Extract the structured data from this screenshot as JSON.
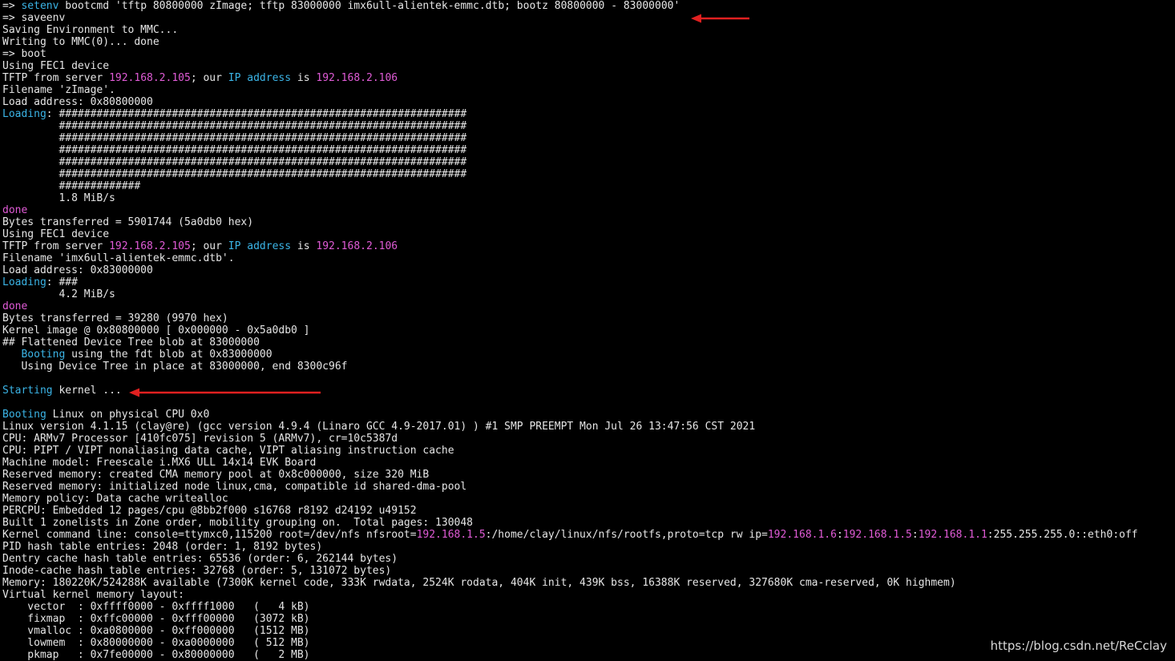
{
  "colors": {
    "background": "#000000",
    "default_text": "#e6e6e6",
    "cyan": "#3bb4e6",
    "magenta": "#e05bd6",
    "arrow": "#e02020"
  },
  "terminal": {
    "lines": [
      [
        [
          "d",
          "=> "
        ],
        [
          "c",
          "setenv"
        ],
        [
          "d",
          " bootcmd 'tftp 80800000 zImage; tftp 83000000 imx6ull-alientek-emmc.dtb; bootz 80800000 - 83000000'"
        ]
      ],
      [
        [
          "d",
          "=> saveenv"
        ]
      ],
      [
        [
          "d",
          "Saving Environment to MMC..."
        ]
      ],
      [
        [
          "d",
          "Writing to MMC(0)... done"
        ]
      ],
      [
        [
          "d",
          "=> boot"
        ]
      ],
      [
        [
          "d",
          "Using FEC1 device"
        ]
      ],
      [
        [
          "d",
          "TFTP from server "
        ],
        [
          "m",
          "192.168.2.105"
        ],
        [
          "d",
          "; our "
        ],
        [
          "c",
          "IP address"
        ],
        [
          "d",
          " is "
        ],
        [
          "m",
          "192.168.2.106"
        ]
      ],
      [
        [
          "d",
          "Filename 'zImage'."
        ]
      ],
      [
        [
          "d",
          "Load address: 0x80800000"
        ]
      ],
      [
        [
          "c",
          "Loading"
        ],
        [
          "d",
          ": #################################################################"
        ]
      ],
      [
        [
          "d",
          "         #################################################################"
        ]
      ],
      [
        [
          "d",
          "         #################################################################"
        ]
      ],
      [
        [
          "d",
          "         #################################################################"
        ]
      ],
      [
        [
          "d",
          "         #################################################################"
        ]
      ],
      [
        [
          "d",
          "         #################################################################"
        ]
      ],
      [
        [
          "d",
          "         #############"
        ]
      ],
      [
        [
          "d",
          "         1.8 MiB/s"
        ]
      ],
      [
        [
          "m",
          "done"
        ]
      ],
      [
        [
          "d",
          "Bytes transferred = 5901744 (5a0db0 hex)"
        ]
      ],
      [
        [
          "d",
          "Using FEC1 device"
        ]
      ],
      [
        [
          "d",
          "TFTP from server "
        ],
        [
          "m",
          "192.168.2.105"
        ],
        [
          "d",
          "; our "
        ],
        [
          "c",
          "IP address"
        ],
        [
          "d",
          " is "
        ],
        [
          "m",
          "192.168.2.106"
        ]
      ],
      [
        [
          "d",
          "Filename 'imx6ull-alientek-emmc.dtb'."
        ]
      ],
      [
        [
          "d",
          "Load address: 0x83000000"
        ]
      ],
      [
        [
          "c",
          "Loading"
        ],
        [
          "d",
          ": ###"
        ]
      ],
      [
        [
          "d",
          "         4.2 MiB/s"
        ]
      ],
      [
        [
          "m",
          "done"
        ]
      ],
      [
        [
          "d",
          "Bytes transferred = 39280 (9970 hex)"
        ]
      ],
      [
        [
          "d",
          "Kernel image @ 0x80800000 [ 0x000000 - 0x5a0db0 ]"
        ]
      ],
      [
        [
          "d",
          "## Flattened Device Tree blob at 83000000"
        ]
      ],
      [
        [
          "d",
          "   "
        ],
        [
          "c",
          "Booting"
        ],
        [
          "d",
          " using the fdt blob at 0x83000000"
        ]
      ],
      [
        [
          "d",
          "   Using Device Tree in place at 83000000, end 8300c96f"
        ]
      ],
      [],
      [
        [
          "c",
          "Starting"
        ],
        [
          "d",
          " kernel ..."
        ]
      ],
      [],
      [
        [
          "c",
          "Booting"
        ],
        [
          "d",
          " Linux on physical CPU 0x0"
        ]
      ],
      [
        [
          "d",
          "Linux version 4.1.15 (clay@re) (gcc version 4.9.4 (Linaro GCC 4.9-2017.01) ) #1 SMP PREEMPT Mon Jul 26 13:47:56 CST 2021"
        ]
      ],
      [
        [
          "d",
          "CPU: ARMv7 Processor [410fc075] revision 5 (ARMv7), cr=10c5387d"
        ]
      ],
      [
        [
          "d",
          "CPU: PIPT / VIPT nonaliasing data cache, VIPT aliasing instruction cache"
        ]
      ],
      [
        [
          "d",
          "Machine model: Freescale i.MX6 ULL 14x14 EVK Board"
        ]
      ],
      [
        [
          "d",
          "Reserved memory: created CMA memory pool at 0x8c000000, size 320 MiB"
        ]
      ],
      [
        [
          "d",
          "Reserved memory: initialized node linux,cma, compatible id shared-dma-pool"
        ]
      ],
      [
        [
          "d",
          "Memory policy: Data cache writealloc"
        ]
      ],
      [
        [
          "d",
          "PERCPU: Embedded 12 pages/cpu @8bb2f000 s16768 r8192 d24192 u49152"
        ]
      ],
      [
        [
          "d",
          "Built 1 zonelists in Zone order, mobility grouping on.  Total pages: 130048"
        ]
      ],
      [
        [
          "d",
          "Kernel command line: console=ttymxc0,115200 root=/dev/nfs nfsroot="
        ],
        [
          "m",
          "192.168.1.5"
        ],
        [
          "d",
          ":/home/clay/linux/nfs/rootfs,proto=tcp rw ip="
        ],
        [
          "m",
          "192.168.1.6"
        ],
        [
          "d",
          ":"
        ],
        [
          "m",
          "192.168.1.5"
        ],
        [
          "d",
          ":"
        ],
        [
          "m",
          "192.168.1.1"
        ],
        [
          "d",
          ":255.255.255.0::eth0:off"
        ]
      ],
      [
        [
          "d",
          "PID hash table entries: 2048 (order: 1, 8192 bytes)"
        ]
      ],
      [
        [
          "d",
          "Dentry cache hash table entries: 65536 (order: 6, 262144 bytes)"
        ]
      ],
      [
        [
          "d",
          "Inode-cache hash table entries: 32768 (order: 5, 131072 bytes)"
        ]
      ],
      [
        [
          "d",
          "Memory: 180220K/524288K available (7300K kernel code, 333K rwdata, 2524K rodata, 404K init, 439K bss, 16388K reserved, 327680K cma-reserved, 0K highmem)"
        ]
      ],
      [
        [
          "d",
          "Virtual kernel memory layout:"
        ]
      ],
      [
        [
          "d",
          "    vector  : 0xffff0000 - 0xffff1000   (   4 kB)"
        ]
      ],
      [
        [
          "d",
          "    fixmap  : 0xffc00000 - 0xfff00000   (3072 kB)"
        ]
      ],
      [
        [
          "d",
          "    vmalloc : 0xa0800000 - 0xff000000   (1512 MB)"
        ]
      ],
      [
        [
          "d",
          "    lowmem  : 0x80000000 - 0xa0000000   ( 512 MB)"
        ]
      ],
      [
        [
          "d",
          "    pkmap   : 0x7fe00000 - 0x80000000   (   2 MB)"
        ]
      ]
    ]
  },
  "watermark": {
    "text": "https://blog.csdn.net/ReCclay"
  },
  "annotations": {
    "arrow_icon": "left-arrow-icon"
  }
}
